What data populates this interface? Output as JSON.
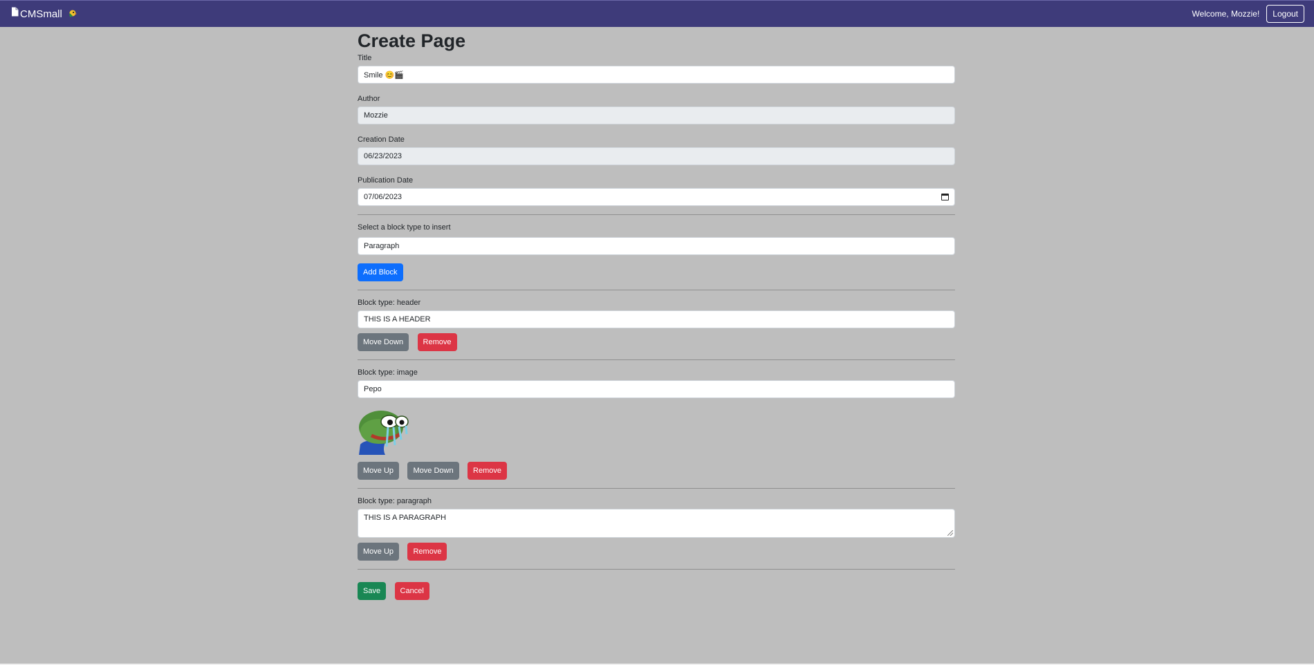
{
  "navbar": {
    "brand": "CMSmall",
    "welcome": "Welcome, Mozzie!",
    "logout_label": "Logout",
    "color": "#3e3b7a"
  },
  "page": {
    "title": "Create Page"
  },
  "form": {
    "title_label": "Title",
    "title_value": "Smile 😊🎬",
    "author_label": "Author",
    "author_value": "Mozzie",
    "creation_label": "Creation Date",
    "creation_value": "06/23/2023",
    "publication_label": "Publication Date",
    "publication_value": "07/06/2023",
    "block_select_label": "Select a block type to insert",
    "block_select_value": "Paragraph",
    "add_block_label": "Add Block"
  },
  "blocks": [
    {
      "type_label": "Block type: header",
      "value": "THIS IS A HEADER"
    },
    {
      "type_label": "Block type: image",
      "value": "Pepo",
      "image_icon": "pepe-frog-crying-icon"
    },
    {
      "type_label": "Block type: paragraph",
      "value": "THIS IS A PARAGRAPH"
    }
  ],
  "buttons": {
    "move_up": "Move Up",
    "move_down": "Move Down",
    "remove": "Remove",
    "save": "Save",
    "cancel": "Cancel"
  },
  "colors": {
    "primary": "#0d6efd",
    "secondary": "#6c757d",
    "danger": "#dc3545",
    "success": "#198754",
    "background": "#bebebe"
  }
}
